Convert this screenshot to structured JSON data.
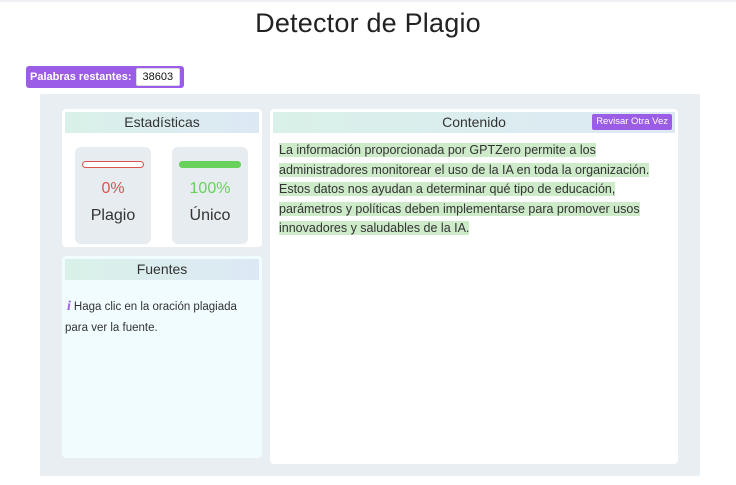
{
  "page": {
    "title": "Detector de Plagio"
  },
  "words_remaining": {
    "label": "Palabras restantes:",
    "count": "38603"
  },
  "stats": {
    "header": "Estadísticas",
    "plagio": {
      "percent_text": "0%",
      "label": "Plagio",
      "bar_fraction": 0.0,
      "color": "#d9534f"
    },
    "unico": {
      "percent_text": "100%",
      "label": "Único",
      "bar_fraction": 1.0,
      "color": "#67d15c"
    }
  },
  "sources": {
    "header": "Fuentes",
    "hint": "Haga clic en la oración plagiada para ver la fuente.",
    "icon": "info-icon"
  },
  "content": {
    "header": "Contenido",
    "recheck_label": "Revisar Otra Vez",
    "text": "La información proporcionada por GPTZero permite a los administradores monitorear el uso de la IA en toda la organización. Estos datos nos ayudan a determinar qué tipo de educación, parámetros y políticas deben implementarse para promover usos innovadores y saludables de la IA."
  },
  "colors": {
    "accent": "#9b5de5",
    "highlight": "#cdeac9",
    "panel_bg": "#e9eef3"
  }
}
